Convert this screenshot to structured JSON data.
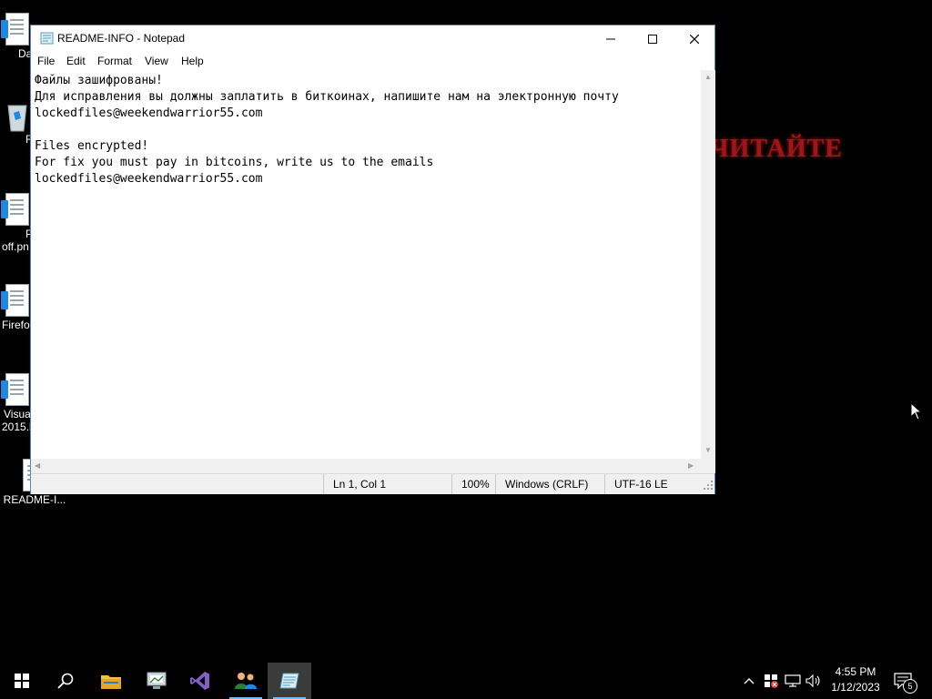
{
  "wallpaper": {
    "text": "ЧИТАЙТЕ"
  },
  "desktop_icons": [
    {
      "label": "DataW"
    },
    {
      "label": "Recy"
    },
    {
      "label_line1": "P",
      "label_line2": "off.pn"
    },
    {
      "label": "Firefo"
    },
    {
      "label_line1": "Visua",
      "label_line2": "2015.l"
    },
    {
      "label": "README-I..."
    }
  ],
  "window": {
    "title": "README-INFO - Notepad",
    "menu": [
      "File",
      "Edit",
      "Format",
      "View",
      "Help"
    ],
    "content": "Файлы зашифрованы!\nДля исправления вы должны заплатить в биткоинах, напишите нам на электронную почту\nlockedfiles@weekendwarrior55.com\n\nFiles encrypted!\nFor fix you must pay in bitcoins, write us to the emails\nlockedfiles@weekendwarrior55.com",
    "status": {
      "position": "Ln 1, Col 1",
      "zoom": "100%",
      "line_ending": "Windows (CRLF)",
      "encoding": "UTF-16 LE"
    }
  },
  "taskbar": {
    "apps": [
      "start-icon",
      "search-icon",
      "file-explorer-icon",
      "server-manager-icon",
      "visual-studio-icon",
      "users-icon",
      "notepad-icon"
    ],
    "active_app": "notepad-icon",
    "clock": {
      "time": "4:55 PM",
      "date": "1/12/2023"
    },
    "notification_count": "5"
  },
  "colors": {
    "desktop_bg": "#000000",
    "wallpaper_text": "#a1141a",
    "window_border": "#4a88c7",
    "taskbar_bg": "#000000",
    "accent": "#76b9ed"
  }
}
